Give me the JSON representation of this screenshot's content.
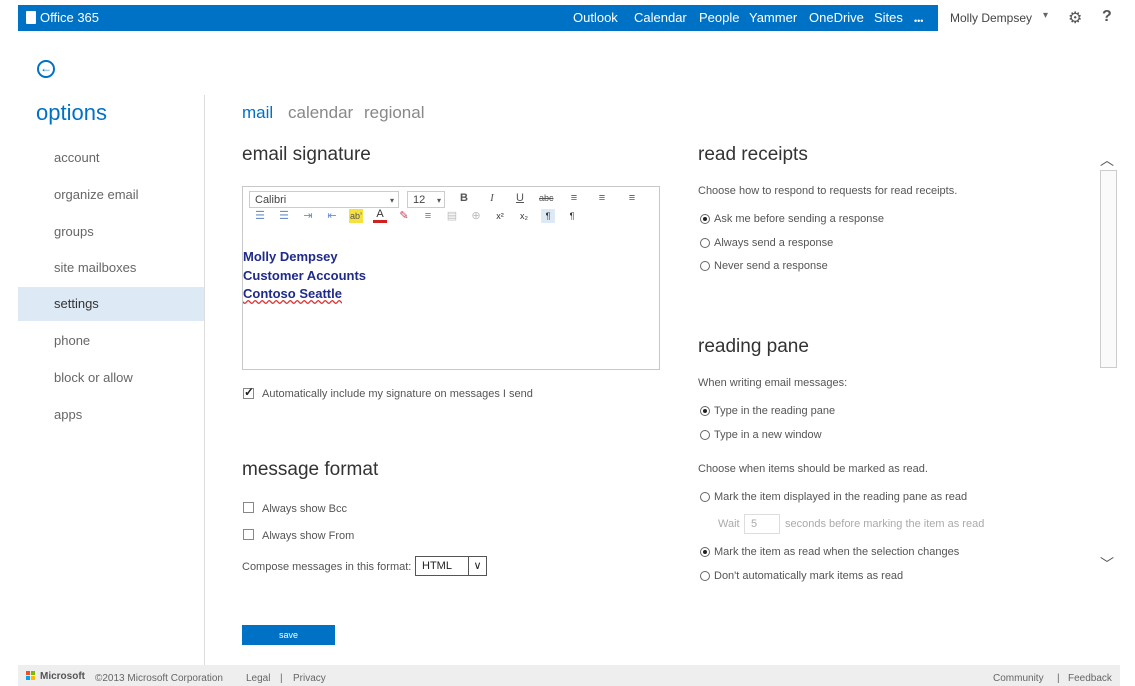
{
  "brand": {
    "name": "Office 365"
  },
  "nav": [
    "Outlook",
    "Calendar",
    "People",
    "Yammer",
    "OneDrive",
    "Sites",
    "•••"
  ],
  "user": {
    "name": "Molly Dempsey",
    "dropdown": "▾",
    "gear": "⚙",
    "help": "?"
  },
  "back_glyph": "←",
  "options_title": "options",
  "sidebar": [
    {
      "label": "account"
    },
    {
      "label": "organize email"
    },
    {
      "label": "groups"
    },
    {
      "label": "site mailboxes"
    },
    {
      "label": "settings",
      "selected": true
    },
    {
      "label": "phone"
    },
    {
      "label": "block or allow"
    },
    {
      "label": "apps"
    }
  ],
  "tabs": [
    {
      "label": "mail",
      "selected": true
    },
    {
      "label": "calendar"
    },
    {
      "label": "regional"
    }
  ],
  "email_signature": {
    "heading": "email signature",
    "font": "Calibri",
    "font_size": "12",
    "toolbar_row1": [
      "B",
      "I",
      "U",
      "abc",
      "≡",
      "≡",
      "≡"
    ],
    "toolbar_row2": [
      "☰",
      "☰",
      "⇥",
      "⇤",
      "ab’",
      "A",
      "✎",
      "≡",
      "▤",
      "⊕",
      "x²",
      "x₂",
      "¶",
      "¶"
    ],
    "lines": [
      "Molly Dempsey",
      "Customer Accounts",
      "Contoso Seattle"
    ],
    "auto_include_label": "Automatically include my signature on messages I send",
    "auto_include_checked": true
  },
  "message_format": {
    "heading": "message format",
    "always_bcc": "Always show Bcc",
    "always_from": "Always show From",
    "compose_label": "Compose messages in this format:",
    "compose_value": "HTML"
  },
  "save_label": "save",
  "read_receipts": {
    "heading": "read receipts",
    "description": "Choose how to respond to requests for read receipts.",
    "options": [
      "Ask me before sending a response",
      "Always send a response",
      "Never send a response"
    ],
    "selected": 0
  },
  "reading_pane": {
    "heading": "reading pane",
    "writing_label": "When writing email messages:",
    "writing_options": [
      "Type in the reading pane",
      "Type in a new window"
    ],
    "writing_selected": 0,
    "mark_label": "Choose when items should be marked as read.",
    "mark_displayed": "Mark the item displayed in the reading pane as read",
    "wait_label": "Wait",
    "wait_value": "5",
    "wait_suffix": "seconds before marking the item as read",
    "mark_selection": "Mark the item as read when the selection changes",
    "mark_never": "Don't automatically mark items as read",
    "mark_selected": 1
  },
  "footer": {
    "microsoft": "Microsoft",
    "copyright": "©2013 Microsoft Corporation",
    "legal": "Legal",
    "privacy": "Privacy",
    "sep": "|",
    "community": "Community",
    "feedback": "Feedback"
  },
  "colors": {
    "brand_blue": "#0072c6",
    "selected_bg": "#dde9f5"
  }
}
